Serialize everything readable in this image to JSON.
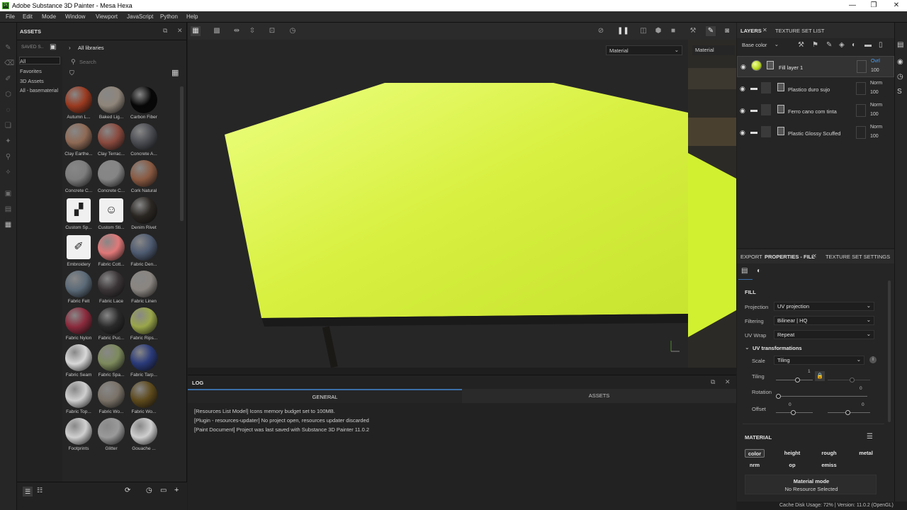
{
  "window": {
    "title": "Adobe Substance 3D Painter - Mesa Hexa",
    "logo": "Pt",
    "minimize": "—",
    "restore": "❐",
    "close": "✕"
  },
  "menu": [
    "File",
    "Edit",
    "Mode",
    "Window",
    "Viewport",
    "JavaScript",
    "Python",
    "Help"
  ],
  "assets": {
    "panel_title": "ASSETS",
    "saved_label": "SAVED S..",
    "all_libraries": "All libraries",
    "search_placeholder": "Search",
    "nav": [
      "All",
      "Favorites",
      "3D Assets",
      "All - basematerial"
    ],
    "items": [
      "Autumn L...",
      "Baked Lig...",
      "Carbon Fiber",
      "Clay Earthe...",
      "Clay Terrac...",
      "Concrete A...",
      "Concrete C...",
      "Concrete C...",
      "Cork Natural",
      "Custom Sp...",
      "Custom Sti...",
      "Denim Rivet",
      "Embroidery",
      "Fabric Cott...",
      "Fabric Den...",
      "Fabric Felt",
      "Fabric Lace",
      "Fabric Linen",
      "Fabric Nylon",
      "Fabric Puc...",
      "Fabric Rips...",
      "Fabric Seam",
      "Fabric Spa...",
      "Fabric Tarp...",
      "Fabric Top...",
      "Fabric Wo...",
      "Fabric Wo...",
      "Footprints",
      "Glitter",
      "Gouache ..."
    ],
    "colors": [
      "#9a3a20",
      "#8f857a",
      "#070707",
      "#8f6a55",
      "#8a4a3e",
      "#4a4c52",
      "#7d7d7d",
      "#858585",
      "#8a5a42",
      "#f0f0f0",
      "#f0f0f0",
      "#2a2622",
      "#f0f0f0",
      "#e07878",
      "#4d5a70",
      "#5b6a78",
      "#3a3436",
      "#8a8580",
      "#8a2a3c",
      "#2a2a2a",
      "#9aa64a",
      "#d8d8d8",
      "#7d8a5c",
      "#2a3a7a",
      "#cfcfcf",
      "#7a7268",
      "#5e4a1c",
      "#d0d0d0",
      "#9a9a9a",
      "#cfcfcf"
    ]
  },
  "viewport": {
    "mode_dropdown": "Material",
    "mode_dropdown2": "Material",
    "fill_color": "#d8f040"
  },
  "log": {
    "title": "LOG",
    "tabs": [
      "GENERAL",
      "ASSETS"
    ],
    "lines": [
      "[Resources List Model] Icons memory budget set to 100MB.",
      "[Plugin - resources-updater] No project open, resources updater discarded",
      "[Paint Document] Project was last saved with Substance 3D Painter 11.0.2"
    ]
  },
  "layers": {
    "tab_layers": "LAYERS",
    "tab_texture_set": "TEXTURE SET LIST",
    "channel": "Base color",
    "rows": [
      {
        "name": "Fill layer 1",
        "blend": "Ovrl",
        "opacity": "100"
      },
      {
        "name": "Plastico duro sujo",
        "blend": "Norm",
        "opacity": "100"
      },
      {
        "name": "Ferro cano com tinta",
        "blend": "Norm",
        "opacity": "100"
      },
      {
        "name": "Plastic Glossy Scuffed",
        "blend": "Norm",
        "opacity": "100"
      }
    ]
  },
  "properties": {
    "tab_export": "EXPORT",
    "tab_props": "PROPERTIES - FILL",
    "tab_tss": "TEXTURE SET SETTINGS",
    "fill_title": "FILL",
    "projection_label": "Projection",
    "projection_value": "UV projection",
    "filtering_label": "Filtering",
    "filtering_value": "Bilinear | HQ",
    "uvwrap_label": "UV Wrap",
    "uvwrap_value": "Repeat",
    "uvtrans_label": "UV transformations",
    "scale_label": "Scale",
    "scale_value": "Tiling",
    "tiling_label": "Tiling",
    "tiling_value": "1",
    "rotation_label": "Rotation",
    "rotation_value": "0",
    "offset_label": "Offset",
    "offset_x": "0",
    "offset_y": "0",
    "material_title": "MATERIAL",
    "channels": [
      "color",
      "height",
      "rough",
      "metal",
      "nrm",
      "op",
      "emiss"
    ],
    "material_mode_label": "Material mode",
    "material_mode_value": "No Resource Selected"
  },
  "status": {
    "text": "Cache Disk Usage:   72% | Version: 11.0.2 (OpenGL)"
  }
}
